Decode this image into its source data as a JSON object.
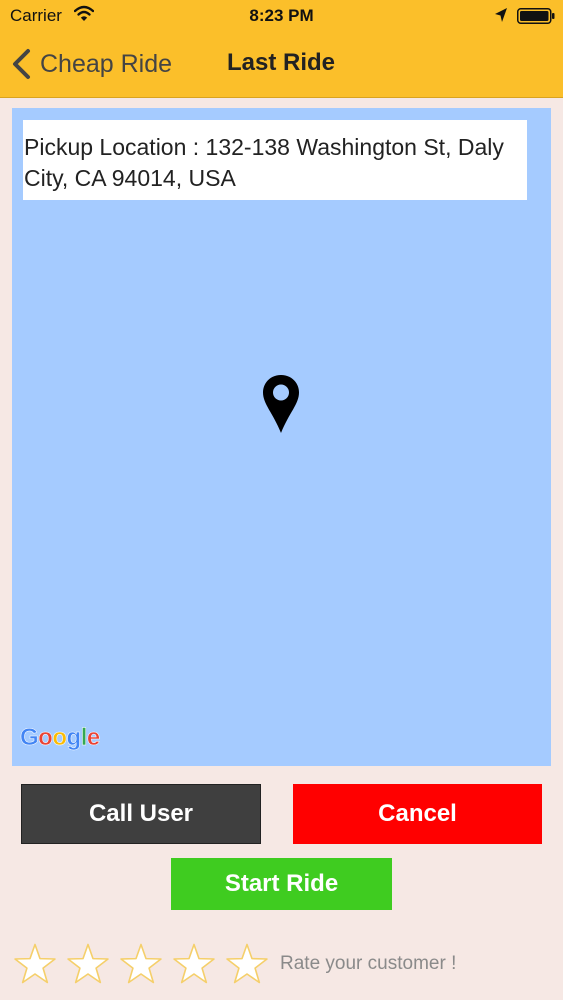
{
  "status_bar": {
    "carrier": "Carrier",
    "time": "8:23 PM",
    "icons": [
      "wifi-icon",
      "location-arrow-icon",
      "battery-icon"
    ]
  },
  "nav": {
    "back_label": "Cheap Ride",
    "title": "Last Ride",
    "back_icon": "chevron-left-icon"
  },
  "map": {
    "pickup_text": "Pickup Location : 132-138 Washington St, Daly City, CA 94014, USA",
    "pin_icon": "map-pin-icon",
    "logo_letters": [
      "G",
      "o",
      "o",
      "g",
      "l",
      "e"
    ],
    "logo_colors": [
      "#4285f4",
      "#ea4335",
      "#fbbc05",
      "#4285f4",
      "#34a853",
      "#ea4335"
    ]
  },
  "actions": {
    "call_label": "Call User",
    "cancel_label": "Cancel",
    "start_label": "Start Ride"
  },
  "rating": {
    "stars_total": 5,
    "stars_filled": 0,
    "label": "Rate your customer !"
  },
  "colors": {
    "nav_bg": "#fbbf2a",
    "page_bg": "#f6e8e4",
    "map_bg": "#a5cbff",
    "call_bg": "#3f3f3f",
    "cancel_bg": "#ff0000",
    "start_bg": "#3fcc20",
    "star_outline": "#f5cf6a"
  }
}
